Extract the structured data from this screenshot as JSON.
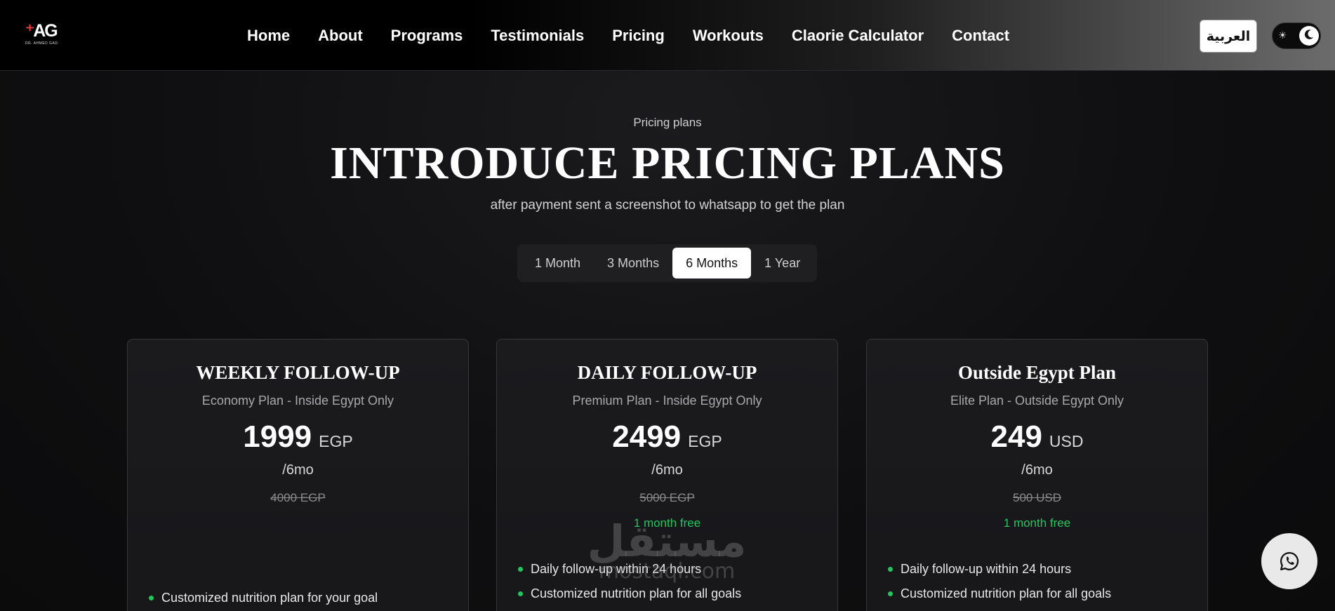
{
  "nav": {
    "logo_text": "AG",
    "logo_subtext": "DR. AHMED GAD",
    "links": [
      "Home",
      "About",
      "Programs",
      "Testimonials",
      "Pricing",
      "Workouts",
      "Claorie Calculator",
      "Contact"
    ],
    "language_button": "العربية"
  },
  "hero": {
    "eyebrow": "Pricing plans",
    "title": "INTRODUCE PRICING PLANS",
    "subtitle": "after payment sent a screenshot to whatsapp to get the plan"
  },
  "tabs": {
    "items": [
      "1 Month",
      "3 Months",
      "6 Months",
      "1 Year"
    ],
    "selected": "6 Months"
  },
  "plans": [
    {
      "title": "WEEKLY FOLLOW-UP",
      "subtitle": "Economy Plan - Inside Egypt Only",
      "price": "1999",
      "currency": "EGP",
      "period": "/6mo",
      "old_price": "4000 EGP",
      "free": "",
      "features": [
        "Customized nutrition plan for your goal"
      ]
    },
    {
      "title": "DAILY FOLLOW-UP",
      "subtitle": "Premium Plan - Inside Egypt Only",
      "price": "2499",
      "currency": "EGP",
      "period": "/6mo",
      "old_price": "5000 EGP",
      "free": "1 month free",
      "features": [
        "Daily follow-up within 24 hours",
        "Customized nutrition plan for all goals"
      ]
    },
    {
      "title": "Outside Egypt Plan",
      "subtitle": "Elite Plan - Outside Egypt Only",
      "price": "249",
      "currency": "USD",
      "period": "/6mo",
      "old_price": "500 USD",
      "free": "1 month free",
      "features": [
        "Daily follow-up within 24 hours",
        "Customized nutrition plan for all goals"
      ]
    }
  ],
  "watermark": {
    "arabic": "مستقل",
    "latin": "mostaql.com"
  },
  "colors": {
    "accent_green": "#22c55e",
    "background": "#0e0e10",
    "card": "#1b1b1e"
  },
  "icons": {
    "theme_toggle": [
      "sun-icon",
      "moon-icon"
    ],
    "floating_button": "whatsapp-icon"
  }
}
